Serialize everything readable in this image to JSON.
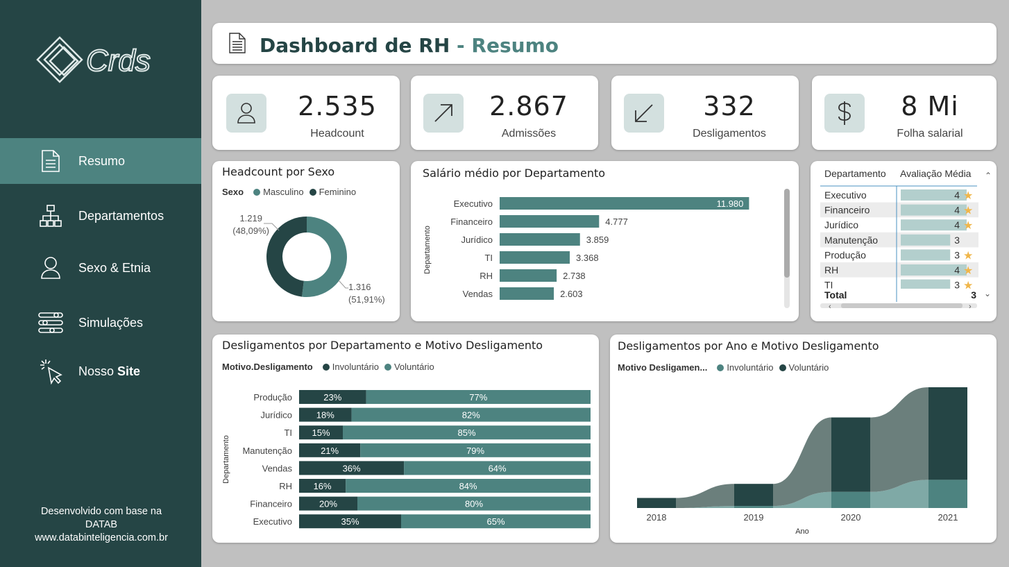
{
  "sidebar": {
    "logo_text": "Crds",
    "items": [
      {
        "label": "Resumo",
        "icon": "document-icon"
      },
      {
        "label": "Departamentos",
        "icon": "org-chart-icon"
      },
      {
        "label": "Sexo & Etnia",
        "icon": "user-icon"
      },
      {
        "label": "Simulações",
        "icon": "sliders-icon"
      },
      {
        "label_prefix": "Nosso ",
        "label_bold": "Site",
        "icon": "click-cursor-icon"
      }
    ],
    "footer": [
      "Desenvolvido com base na",
      "DATAB",
      "www.databinteligencia.com.br"
    ]
  },
  "header": {
    "title": "Dashboard de RH",
    "subtitle": " - Resumo"
  },
  "kpis": [
    {
      "value": "2.535",
      "label": "Headcount",
      "icon": "user-icon"
    },
    {
      "value": "2.867",
      "label": "Admissões",
      "icon": "arrow-up-right-icon"
    },
    {
      "value": "332",
      "label": "Desligamentos",
      "icon": "arrow-down-left-icon"
    },
    {
      "value": "8 Mi",
      "label": "Folha salarial",
      "icon": "dollar-icon"
    }
  ],
  "colors": {
    "dark": "#254545",
    "teal": "#4d8380",
    "grey": "#6b7f7c",
    "light_teal": "#7fa9a6"
  },
  "chart_data": [
    {
      "type": "pie",
      "title": "Headcount por Sexo",
      "legend_title": "Sexo",
      "series": [
        {
          "name": "Masculino",
          "value": 1316,
          "label": "1.316",
          "pct": "(51,91%)"
        },
        {
          "name": "Feminino",
          "value": 1219,
          "label": "1.219",
          "pct": "(48,09%)"
        }
      ]
    },
    {
      "type": "bar",
      "title": "Salário médio por Departamento",
      "ylabel": "Departamento",
      "categories": [
        "Executivo",
        "Financeiro",
        "Jurídico",
        "TI",
        "RH",
        "Vendas"
      ],
      "values": [
        11980,
        4777,
        3859,
        3368,
        2738,
        2603
      ],
      "labels": [
        "11.980",
        "4.777",
        "3.859",
        "3.368",
        "2.738",
        "2.603"
      ],
      "xlim": [
        0,
        12000
      ]
    },
    {
      "type": "table",
      "columns": [
        "Departamento",
        "Avaliação Média"
      ],
      "rows": [
        {
          "dept": "Executivo",
          "value": 4,
          "star": true
        },
        {
          "dept": "Financeiro",
          "value": 4,
          "star": true
        },
        {
          "dept": "Jurídico",
          "value": 4,
          "star": true
        },
        {
          "dept": "Manutenção",
          "value": 3,
          "star": false
        },
        {
          "dept": "Produção",
          "value": 3,
          "star": true
        },
        {
          "dept": "RH",
          "value": 4,
          "star": true
        },
        {
          "dept": "TI",
          "value": 3,
          "star": true
        }
      ],
      "total_label": "Total",
      "total_value": "3"
    },
    {
      "type": "bar",
      "stacked": "100%",
      "title": "Desligamentos por Departamento e Motivo Desligamento",
      "legend_title": "Motivo.Desligamento",
      "ylabel": "Departamento",
      "categories": [
        "Produção",
        "Jurídico",
        "TI",
        "Manutenção",
        "Vendas",
        "RH",
        "Financeiro",
        "Executivo"
      ],
      "series": [
        {
          "name": "Involuntário",
          "values": [
            23,
            18,
            15,
            21,
            36,
            16,
            20,
            35
          ]
        },
        {
          "name": "Voluntário",
          "values": [
            77,
            82,
            85,
            79,
            64,
            84,
            80,
            65
          ]
        }
      ]
    },
    {
      "type": "area",
      "title": "Desligamentos por Ano e Motivo Desligamento",
      "legend_title": "Motivo Desligamen...",
      "xlabel": "Ano",
      "x": [
        "2018",
        "2019",
        "2020",
        "2021"
      ],
      "series": [
        {
          "name": "Involuntário",
          "values": [
            0,
            1,
            8,
            14
          ]
        },
        {
          "name": "Voluntário",
          "values": [
            5,
            11,
            37,
            46
          ]
        }
      ],
      "legend": [
        "Involuntário",
        "Voluntário"
      ]
    }
  ]
}
